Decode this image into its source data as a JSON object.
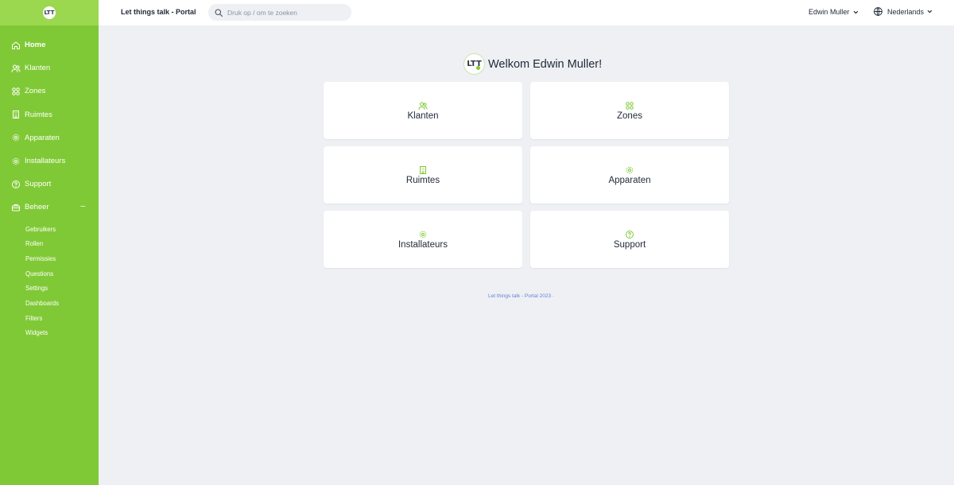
{
  "brand": {
    "logo_text": "LTT"
  },
  "header": {
    "title": "Let things talk - Portal",
    "search_placeholder": "Druk op / om te zoeken",
    "user_name": "Edwin Muller",
    "language": "Nederlands"
  },
  "sidebar": {
    "items": [
      {
        "label": "Home",
        "icon": "home-icon"
      },
      {
        "label": "Klanten",
        "icon": "users-icon"
      },
      {
        "label": "Zones",
        "icon": "grid-icon"
      },
      {
        "label": "Ruimtes",
        "icon": "building-icon"
      },
      {
        "label": "Apparaten",
        "icon": "cog-icon"
      },
      {
        "label": "Installateurs",
        "icon": "cog-icon"
      },
      {
        "label": "Support",
        "icon": "help-icon"
      },
      {
        "label": "Beheer",
        "icon": "briefcase-icon",
        "expanded_sign": "–"
      }
    ],
    "subitems": [
      "Gebruikers",
      "Rollen",
      "Permissies",
      "Questions",
      "Settings",
      "Dashboards",
      "Filters",
      "Widgets"
    ]
  },
  "main": {
    "welcome": "Welkom Edwin Muller!",
    "cards": [
      {
        "label": "Klanten",
        "icon": "users-icon"
      },
      {
        "label": "Zones",
        "icon": "grid-icon"
      },
      {
        "label": "Ruimtes",
        "icon": "building-icon"
      },
      {
        "label": "Apparaten",
        "icon": "cog-icon"
      },
      {
        "label": "Installateurs",
        "icon": "cog-icon"
      },
      {
        "label": "Support",
        "icon": "help-icon"
      }
    ],
    "footer": "Let things talk - Portal 2023 ·"
  },
  "colors": {
    "accent": "#80c936",
    "sidebar_top": "#9bd84f",
    "background": "#eef0f4",
    "footer_link": "#6b7fd7"
  }
}
